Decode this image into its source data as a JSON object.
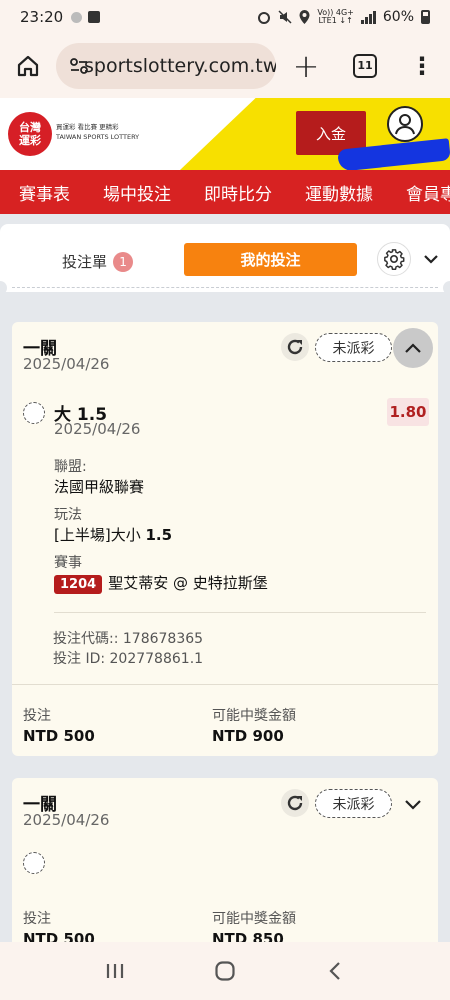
{
  "status_bar": {
    "time": "23:20",
    "network_top": "Vo)) 4G+",
    "network_bottom": "LTE1 ↓↑",
    "battery": "60%"
  },
  "browser": {
    "url": "sportslottery.com.tw",
    "tab_count": "11"
  },
  "site": {
    "logo_line1": "台灣",
    "logo_line2": "運彩",
    "logo_tagline": "買運彩 看比賽 更精彩",
    "logo_english": "TAIWAN SPORTS LOTTERY",
    "deposit_label": "入金"
  },
  "nav": {
    "items": [
      "賽事表",
      "場中投注",
      "即時比分",
      "運動數據",
      "會員專"
    ]
  },
  "panel": {
    "slip_label": "投注單",
    "slip_count": "1",
    "my_bets_label": "我的投注"
  },
  "bets": [
    {
      "title": "一關",
      "date": "2025/04/26",
      "status": "未派彩",
      "selection": "大 1.5",
      "selection_date": "2025/04/26",
      "odds": "1.80",
      "league_label": "聯盟:",
      "league": "法國甲級聯賽",
      "market_label": "玩法",
      "market_prefix": "[上半場]大小 ",
      "market_line": "1.5",
      "event_label": "賽事",
      "match_no": "1204",
      "match": "聖艾蒂安 @ 史特拉斯堡",
      "bet_code": "投注代碼:: 178678365",
      "bet_id": "投注 ID: 202778861.1",
      "stake_label": "投注",
      "stake": "NTD 500",
      "payout_label": "可能中獎金額",
      "payout": "NTD 900"
    },
    {
      "title": "一關",
      "date": "2025/04/26",
      "status": "未派彩",
      "stake_label": "投注",
      "stake": "NTD 500",
      "payout_label": "可能中獎金額",
      "payout": "NTD 850"
    }
  ]
}
